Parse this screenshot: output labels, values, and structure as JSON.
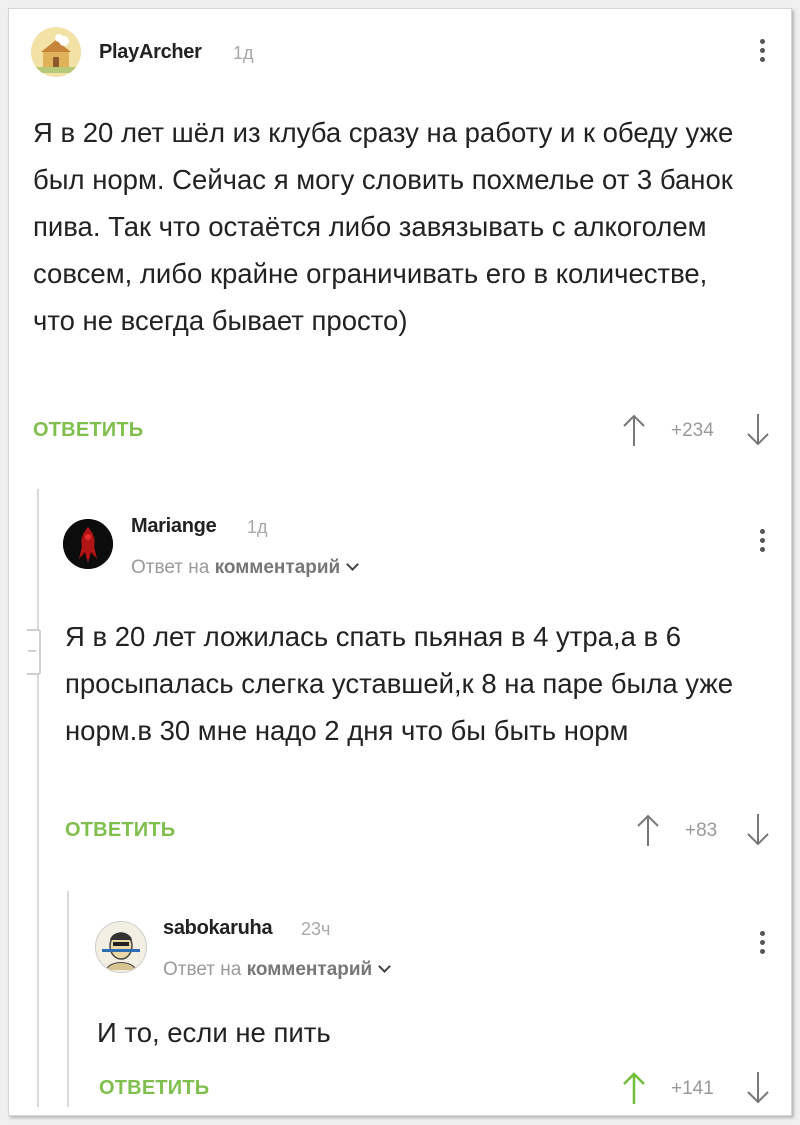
{
  "comments": [
    {
      "author": "PlayArcher",
      "time": "1д",
      "text": "Я в 20 лет шёл из клуба сразу на работу и к обеду уже был норм. Сейчас я могу словить похмелье от 3 банок пива. Так что остаётся либо завязывать с алкоголем совсем, либо крайне ограничивать его в количестве, что не всегда бывает просто)",
      "reply_label": "ОТВЕТИТЬ",
      "score": "+234"
    },
    {
      "author": "Mariange",
      "time": "1д",
      "reply_to_prefix": "Ответ на",
      "reply_to_target": "комментарий",
      "text": "Я в 20 лет ложилась спать пьяная в 4 утра,а в 6 просыпалась слегка уставшей,к 8 на паре была уже норм.в 30 мне надо 2 дня что бы быть норм",
      "reply_label": "ОТВЕТИТЬ",
      "score": "+83"
    },
    {
      "author": "sabokaruha",
      "time": "23ч",
      "reply_to_prefix": "Ответ на",
      "reply_to_target": "комментарий",
      "text": "И то, если не пить",
      "reply_label": "ОТВЕТИТЬ",
      "score": "+141"
    }
  ],
  "colors": {
    "accent_green": "#7fbf4d",
    "text": "#222222",
    "muted": "#a8a8a8",
    "thread_line": "#d9d9d9",
    "upvoted": "#6fbf3a"
  },
  "icons": [
    "more-vertical-icon",
    "arrow-up-icon",
    "arrow-down-icon",
    "chevron-down-icon",
    "collapse-icon"
  ]
}
